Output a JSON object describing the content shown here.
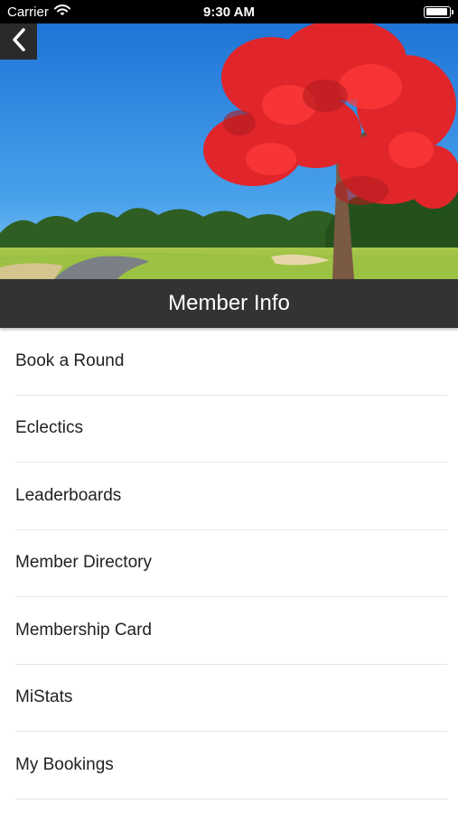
{
  "status_bar": {
    "carrier": "Carrier",
    "time": "9:30 AM",
    "battery_level": 0.95
  },
  "header": {
    "back_icon": "chevron-left-icon",
    "title": "Member Info"
  },
  "menu": {
    "items": [
      {
        "label": "Book a Round"
      },
      {
        "label": "Eclectics"
      },
      {
        "label": "Leaderboards"
      },
      {
        "label": "Member Directory"
      },
      {
        "label": "Membership Card"
      },
      {
        "label": "MiStats"
      },
      {
        "label": "My Bookings"
      }
    ]
  },
  "colors": {
    "title_bar": "#333333",
    "status_bar": "#000000",
    "divider": "#e6e6e6",
    "text": "#222222"
  }
}
